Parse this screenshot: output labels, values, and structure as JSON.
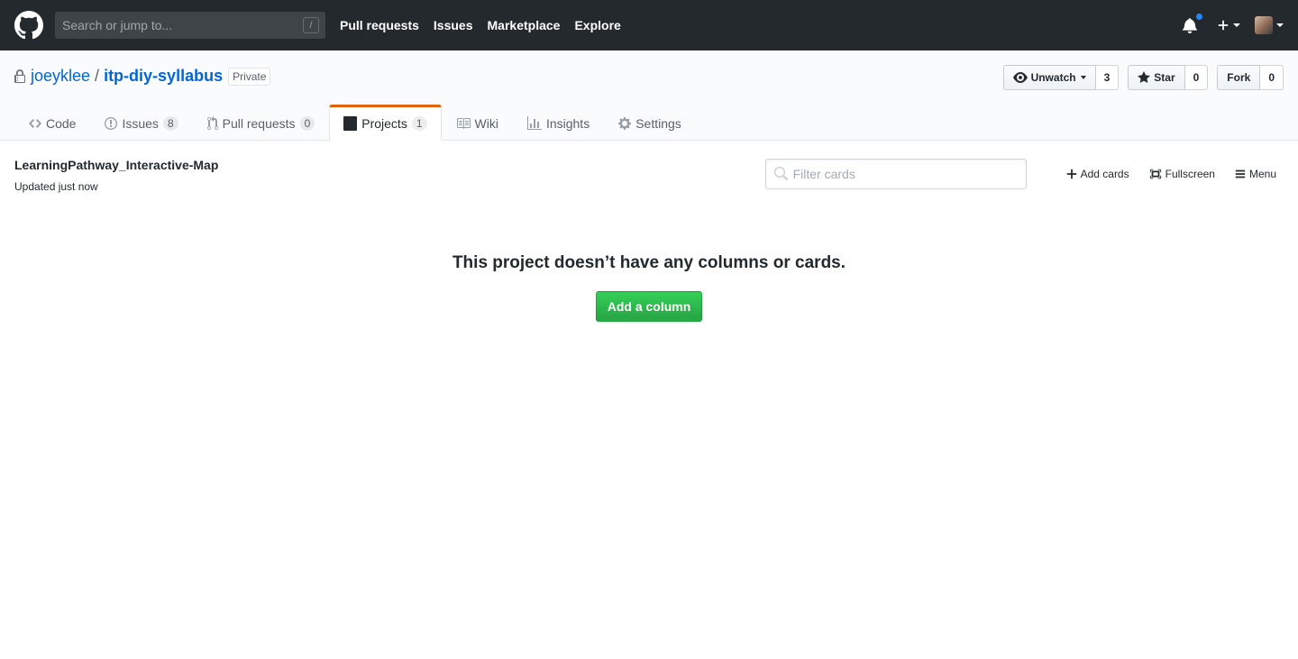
{
  "header": {
    "search_placeholder": "Search or jump to...",
    "search_key": "/",
    "nav": [
      "Pull requests",
      "Issues",
      "Marketplace",
      "Explore"
    ],
    "notification_color": "#2188ff"
  },
  "repo": {
    "owner": "joeyklee",
    "separator": "/",
    "name": "itp-diy-syllabus",
    "visibility": "Private",
    "actions": {
      "watch_label": "Unwatch",
      "watch_count": "3",
      "star_label": "Star",
      "star_count": "0",
      "fork_label": "Fork",
      "fork_count": "0"
    },
    "tabs": [
      {
        "label": "Code",
        "icon": "code-icon"
      },
      {
        "label": "Issues",
        "counter": "8",
        "icon": "issue-icon"
      },
      {
        "label": "Pull requests",
        "counter": "0",
        "icon": "pull-request-icon"
      },
      {
        "label": "Projects",
        "counter": "1",
        "icon": "project-icon",
        "selected": true
      },
      {
        "label": "Wiki",
        "icon": "book-icon"
      },
      {
        "label": "Insights",
        "icon": "graph-icon"
      },
      {
        "label": "Settings",
        "icon": "gear-icon"
      }
    ]
  },
  "project": {
    "name": "LearningPathway_Interactive-Map",
    "updated": "Updated just now",
    "filter_placeholder": "Filter cards",
    "add_cards_label": "Add cards",
    "fullscreen_label": "Fullscreen",
    "menu_label": "Menu"
  },
  "blankslate": {
    "message": "This project doesn’t have any columns or cards.",
    "button_label": "Add a column"
  },
  "colors": {
    "header_bg": "#24292e",
    "link": "#0366d6",
    "selected_tab_accent": "#e36209",
    "primary_button": "#28a745"
  }
}
